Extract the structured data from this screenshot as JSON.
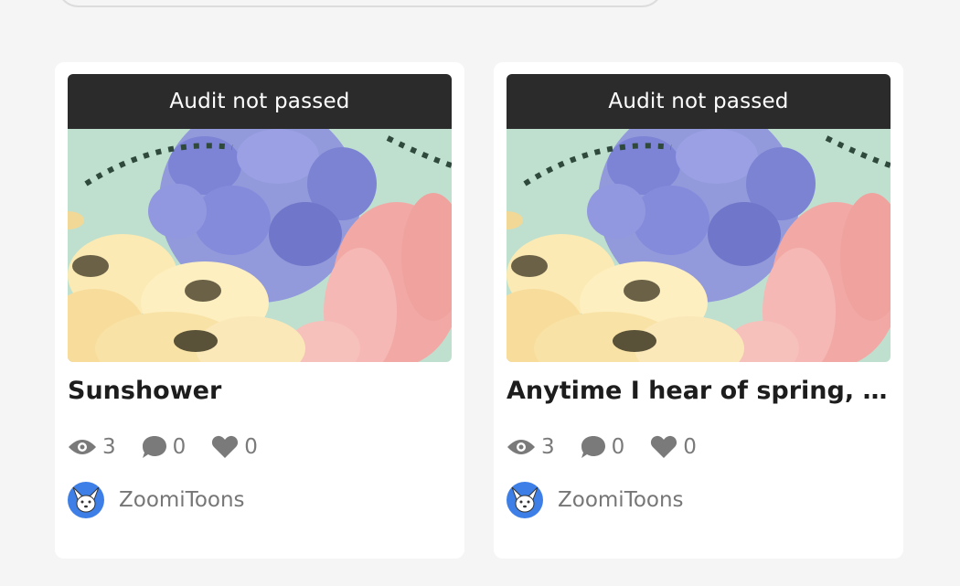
{
  "cards": [
    {
      "status": "Audit not passed",
      "title": "Sunshower",
      "views": "3",
      "comments": "0",
      "likes": "0",
      "author": "ZoomiToons"
    },
    {
      "status": "Audit not passed",
      "title": "Anytime I hear of spring, I thi…",
      "views": "3",
      "comments": "0",
      "likes": "0",
      "author": "ZoomiToons"
    }
  ],
  "icons": {
    "views": "eye-icon",
    "comments": "speech-bubble-icon",
    "likes": "heart-icon"
  },
  "colors": {
    "page_bg": "#f5f5f5",
    "card_bg": "#ffffff",
    "banner_bg": "#2b2b2b",
    "avatar_bg": "#3d7fe6",
    "stat_gray": "#7a7a7a"
  }
}
